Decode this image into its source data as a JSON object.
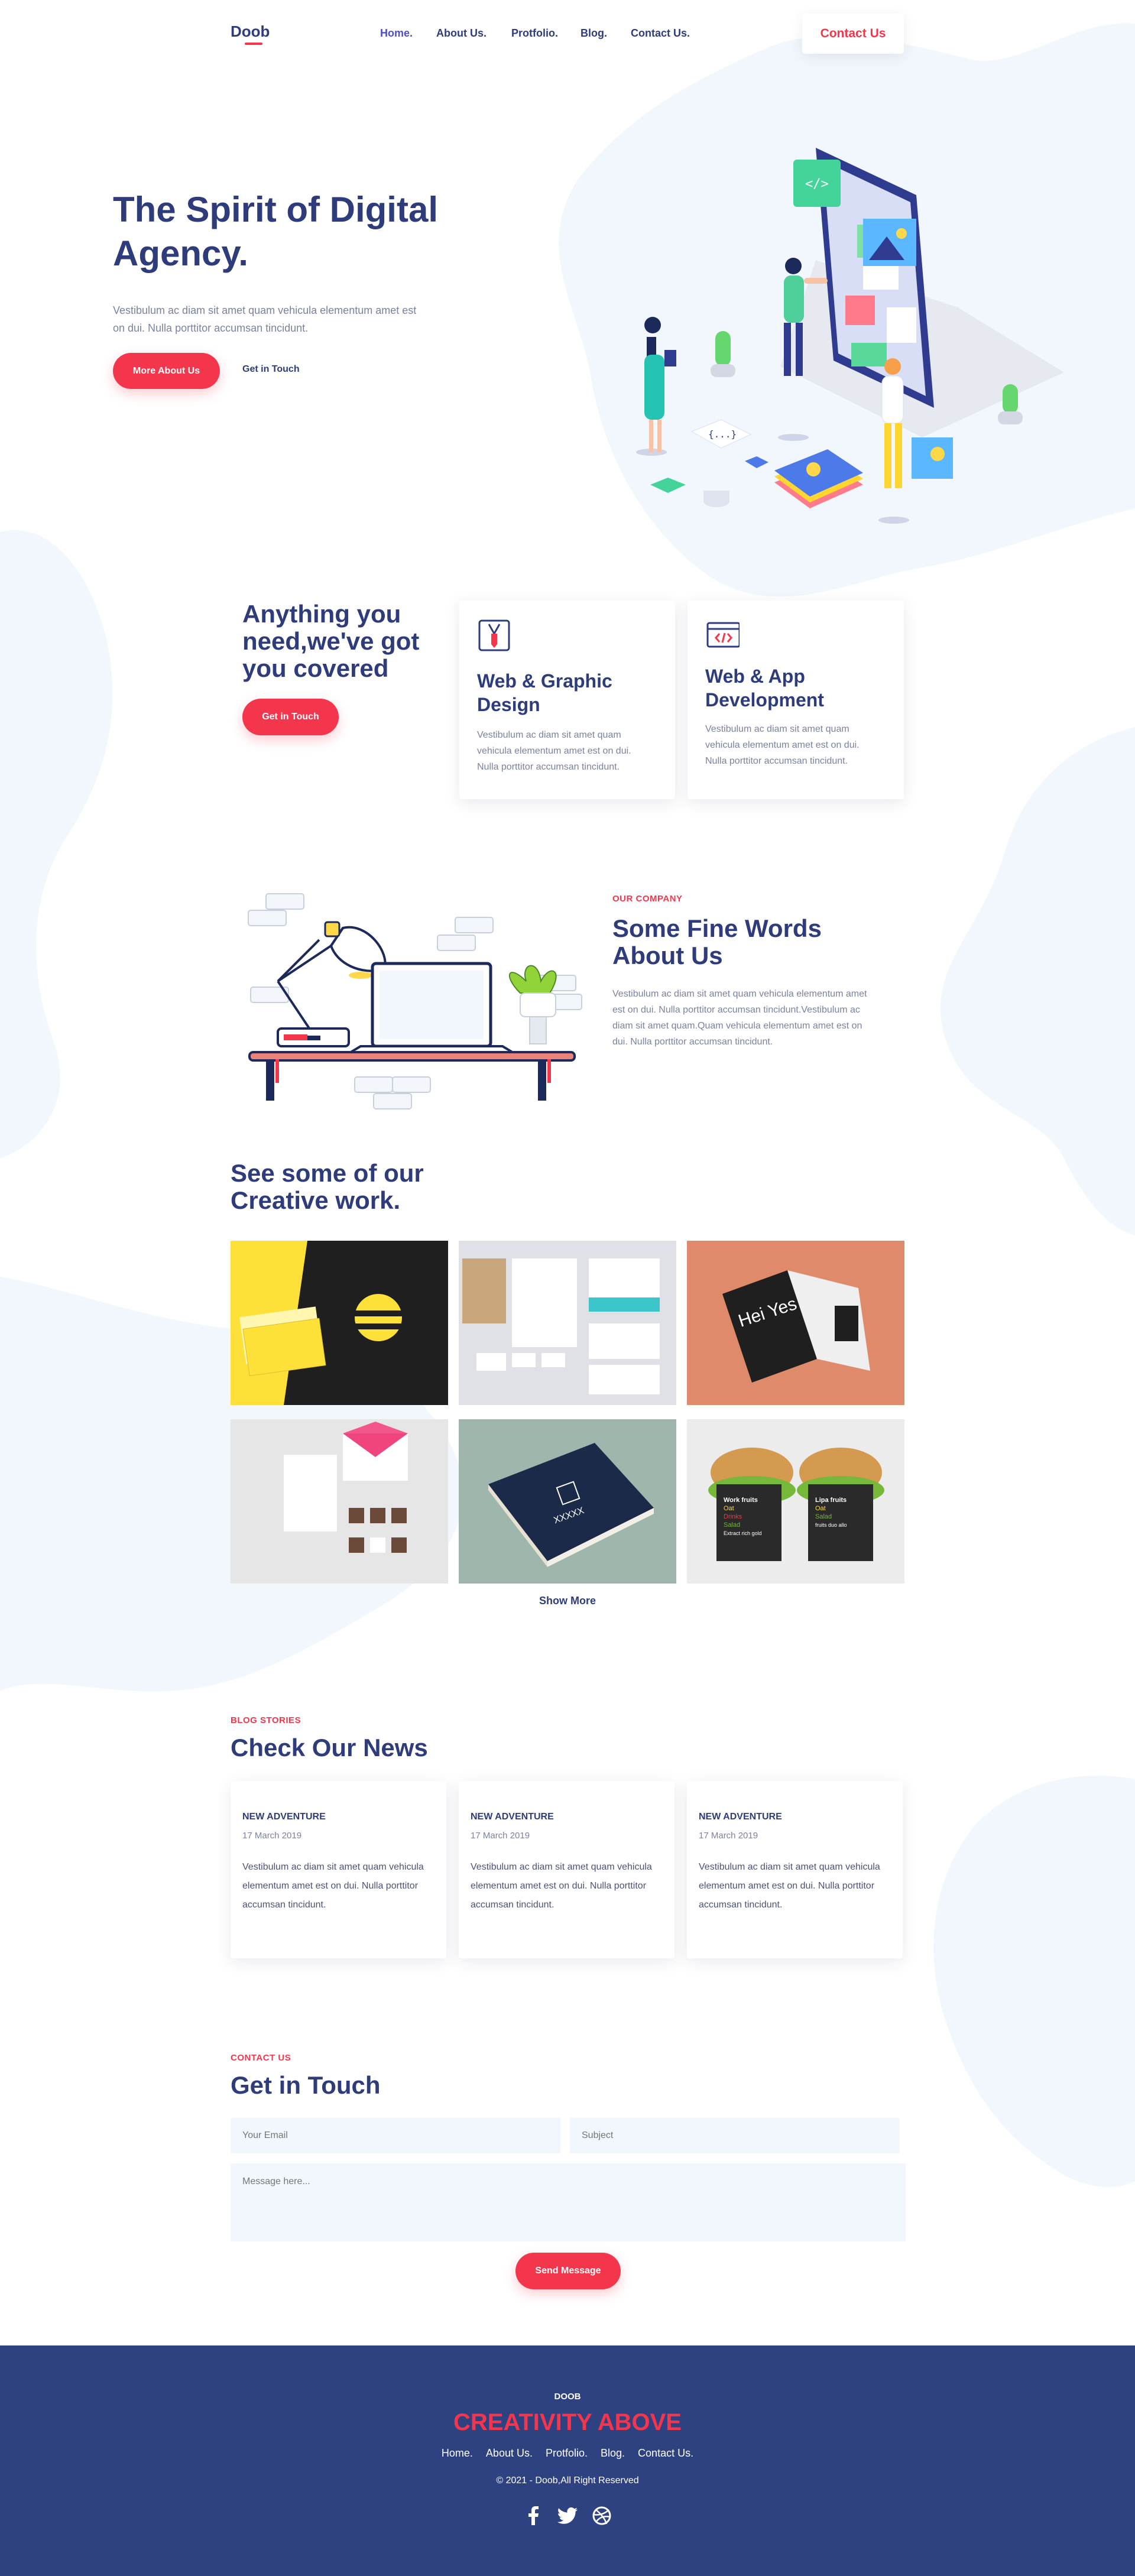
{
  "header": {
    "logo": "Doob",
    "nav": [
      "Home.",
      "About Us.",
      "Protfolio.",
      "Blog.",
      "Contact Us."
    ],
    "cta": "Contact Us"
  },
  "hero": {
    "title": "The Spirit of Digital Agency.",
    "text": "Vestibulum ac diam sit amet quam vehicula elementum amet est on dui. Nulla porttitor accumsan tincidunt.",
    "primary_button": "More About Us",
    "secondary_link": "Get in Touch"
  },
  "services": {
    "title": "Anything you need,we've got you covered",
    "button": "Get in Touch",
    "cards": [
      {
        "icon": "pen-tool-icon",
        "title": "Web & Graphic Design",
        "text": "Vestibulum ac diam sit amet quam vehicula elementum amet est on dui. Nulla porttitor accumsan tincidunt."
      },
      {
        "icon": "code-window-icon",
        "title": "Web & App Development",
        "text": "Vestibulum ac diam sit amet quam vehicula elementum amet est on dui. Nulla porttitor accumsan tincidunt."
      }
    ]
  },
  "about": {
    "kicker": "OUR COMPANY",
    "title": "Some Fine Words About Us",
    "text": "Vestibulum ac diam sit amet quam vehicula elementum amet est on dui. Nulla porttitor accumsan tincidunt.Vestibulum ac diam sit amet quam.Quam vehicula elementum amet est on dui. Nulla porttitor accumsan tincidunt."
  },
  "portfolio": {
    "title": "See some of our Creative work.",
    "show_more": "Show More",
    "tile_texts": {
      "book_cover": "Hei Yes",
      "cover_title": "XXXXX",
      "left_box": [
        "Work fruits",
        "Oat",
        "Drinks",
        "Salad",
        "Extract rich gold"
      ],
      "right_box": [
        "Lipa fruits",
        "Oat",
        "Salad",
        "fruits duo allo"
      ]
    }
  },
  "blog": {
    "kicker": "BLOG STORIES",
    "title": "Check Our News",
    "posts": [
      {
        "title": "NEW ADVENTURE",
        "date": "17 March 2019",
        "text": "Vestibulum ac diam sit amet quam vehicula elementum amet est on dui. Nulla porttitor accumsan tincidunt."
      },
      {
        "title": "NEW ADVENTURE",
        "date": "17 March 2019",
        "text": "Vestibulum ac diam sit amet quam vehicula elementum amet est on dui. Nulla porttitor accumsan tincidunt."
      },
      {
        "title": "NEW ADVENTURE",
        "date": "17 March 2019",
        "text": "Vestibulum ac diam sit amet quam vehicula elementum amet est on dui. Nulla porttitor accumsan tincidunt."
      }
    ]
  },
  "contact": {
    "kicker": "CONTACT US",
    "title": "Get in Touch",
    "email_placeholder": "Your Email",
    "subject_placeholder": "Subject",
    "message_placeholder": "Message here...",
    "button": "Send Message"
  },
  "footer": {
    "brand": "DOOB",
    "slogan": "CREATIVITY ABOVE",
    "nav": [
      "Home.",
      "About Us.",
      "Protfolio.",
      "Blog.",
      "Contact Us."
    ],
    "copyright": "© 2021 - Doob,All Right Reserved",
    "social": [
      "facebook-icon",
      "twitter-icon",
      "dribbble-icon"
    ]
  },
  "colors": {
    "brand_navy": "#2e3c7b",
    "accent_red": "#f4364c",
    "footer_bg": "#2e4282",
    "blob_bg": "#f2f7fd"
  }
}
